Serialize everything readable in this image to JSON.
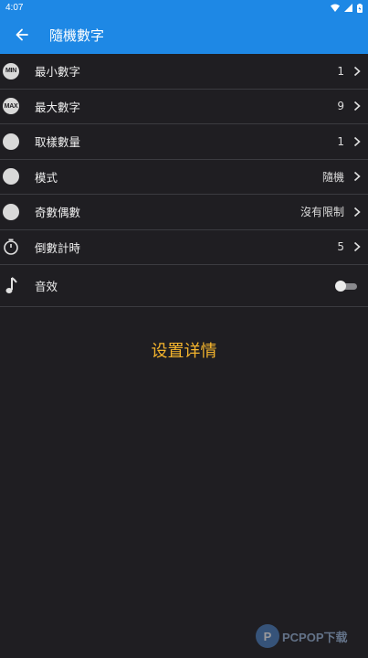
{
  "status_bar": {
    "time": "4:07"
  },
  "app_bar": {
    "title": "隨機數字",
    "back_icon": "arrow-left-icon"
  },
  "settings": [
    {
      "icon": "min-icon",
      "icon_text": "MIN",
      "label": "最小數字",
      "value": "1"
    },
    {
      "icon": "max-icon",
      "icon_text": "MAX",
      "label": "最大數字",
      "value": "9"
    },
    {
      "icon": "circle-icon",
      "icon_text": "",
      "label": "取樣數量",
      "value": "1"
    },
    {
      "icon": "circle-icon",
      "icon_text": "",
      "label": "模式",
      "value": "隨機"
    },
    {
      "icon": "circle-icon",
      "icon_text": "",
      "label": "奇數偶數",
      "value": "沒有限制"
    },
    {
      "icon": "timer-icon",
      "icon_text": "",
      "label": "倒數計時",
      "value": "5"
    }
  ],
  "sound": {
    "label": "音效",
    "icon": "music-note-icon",
    "enabled": false
  },
  "details_link": "设置详情",
  "watermark": {
    "text": "PCPOP下载",
    "logo_letter": "P"
  },
  "colors": {
    "primary": "#1e88e5",
    "background": "#1f1e22",
    "accent_text": "#f5b52d"
  }
}
